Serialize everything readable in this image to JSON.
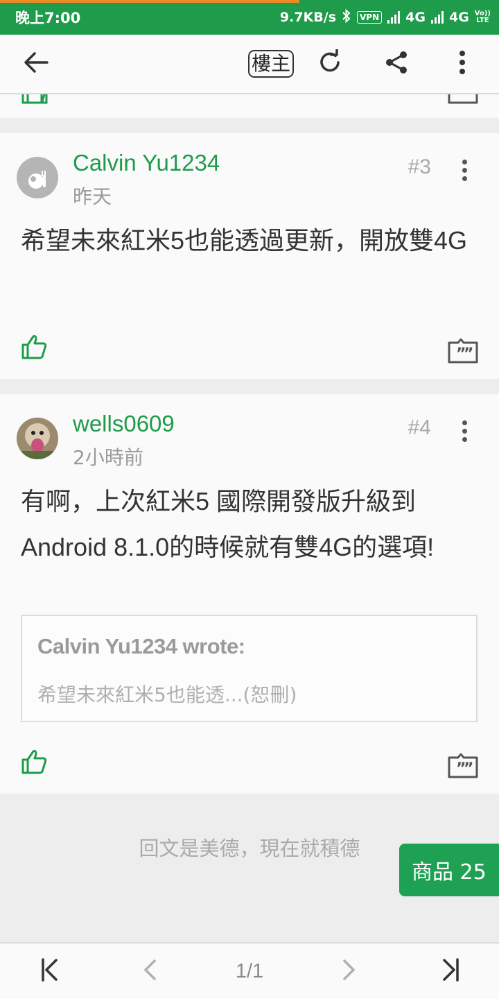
{
  "status_bar": {
    "time": "晚上7:00",
    "net_speed": "9.7KB/s",
    "vpn": "VPN",
    "sim1_type": "4G",
    "sim2_type": "4G",
    "volte_top": "Vo))",
    "volte_bottom": "LTE"
  },
  "toolbar": {
    "poster_only_label": "樓主",
    "icons": [
      "arrow-left-icon",
      "refresh-icon",
      "share-icon",
      "more-vertical-icon"
    ]
  },
  "posts": [
    {
      "author": "Calvin Yu1234",
      "time": "昨天",
      "floor": "#3",
      "body": "希望未來紅米5也能透過更新，開放雙4G"
    },
    {
      "author": "wells0609",
      "time": "2小時前",
      "floor": "#4",
      "body": "有啊，上次紅米5 國際開發版升級到Android 8.1.0的時候就有雙4G的選項!",
      "quote": {
        "author_line": "Calvin Yu1234 wrote:",
        "text": "希望未來紅米5也能透...(恕刪)"
      }
    }
  ],
  "footer_note": "回文是美德，現在就積德",
  "shop_button": "商品 25",
  "pagination": {
    "current": "1/1",
    "icons": [
      "first-page-icon",
      "prev-page-icon",
      "next-page-icon",
      "last-page-icon"
    ]
  },
  "colors": {
    "brand_green": "#1e9b4b",
    "status_bar": "#1e9b4b",
    "progress": "#f08a24"
  }
}
